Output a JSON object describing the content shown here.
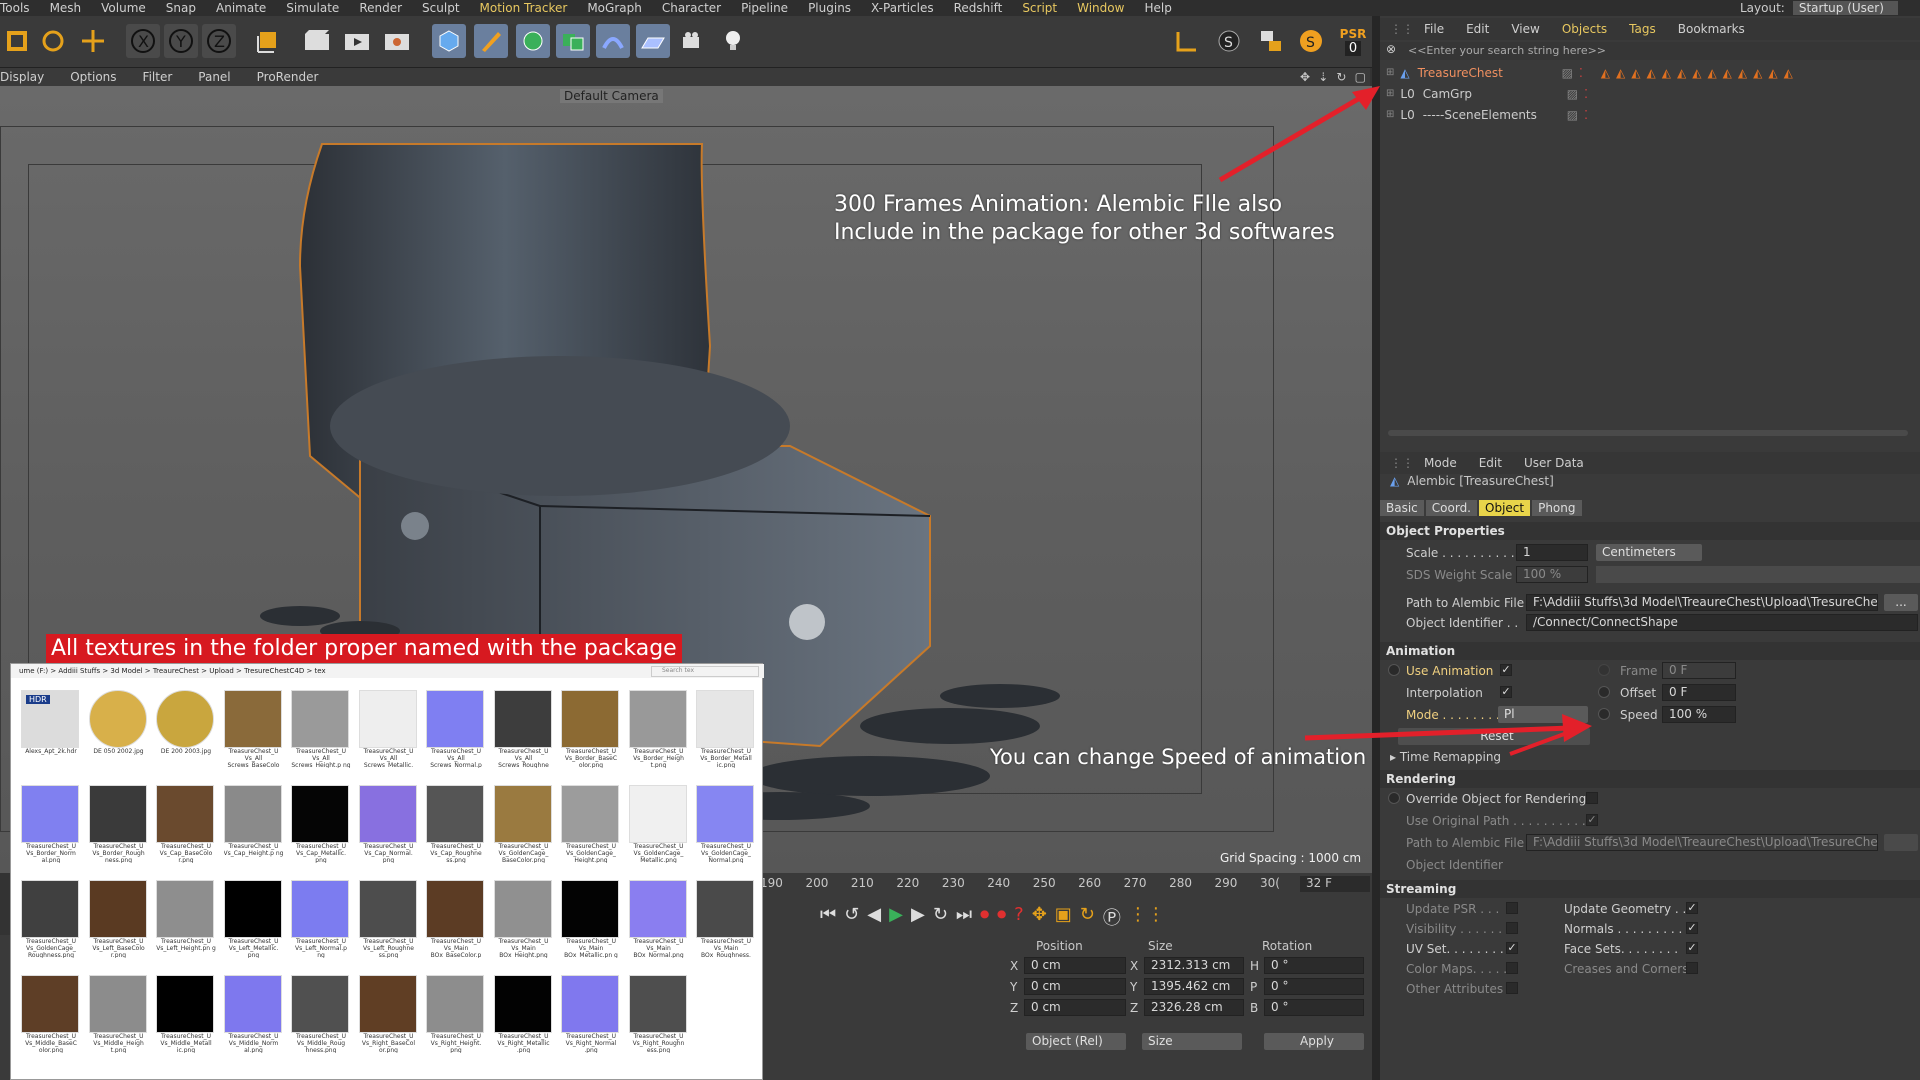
{
  "menubar": [
    "Tools",
    "Mesh",
    "Volume",
    "Snap",
    "Animate",
    "Simulate",
    "Render",
    "Sculpt",
    "Motion Tracker",
    "MoGraph",
    "Character",
    "Pipeline",
    "Plugins",
    "X-Particles",
    "Redshift",
    "Script",
    "Window",
    "Help"
  ],
  "layout": {
    "label": "Layout:",
    "value": "Startup (User)"
  },
  "toolbar": {
    "psr_label": "PSR",
    "psr_value": "0"
  },
  "viewport_menu": [
    "Display",
    "Options",
    "Filter",
    "Panel",
    "ProRender"
  ],
  "viewport": {
    "camera": "Default Camera",
    "grid_spacing": "Grid Spacing : 1000 cm",
    "annotation_top_line1": "300 Frames Animation: Alembic FIle also",
    "annotation_top_line2": "Include in the package for other 3d softwares",
    "annotation_speed": "You can change Speed of animation",
    "annotation_textures": "All textures in the folder proper named with the package"
  },
  "object_manager": {
    "menu": [
      "File",
      "Edit",
      "View",
      "Objects",
      "Tags",
      "Bookmarks"
    ],
    "search_placeholder": "<<Enter your search string here>>",
    "objects": [
      {
        "name": "TreasureChest",
        "selected": true
      },
      {
        "name": "CamGrp"
      },
      {
        "name": "-----SceneElements"
      }
    ]
  },
  "attributes": {
    "menu": [
      "Mode",
      "Edit",
      "User Data"
    ],
    "title": "Alembic [TreasureChest]",
    "tabs": [
      "Basic",
      "Coord.",
      "Object",
      "Phong"
    ],
    "active_tab": "Object",
    "object_properties": "Object Properties",
    "scale_label": "Scale . . . . . . . . . .",
    "scale_value": "1",
    "scale_unit": "Centimeters",
    "sds_label": "SDS Weight Scale",
    "sds_value": "100 %",
    "path_label": "Path to Alembic File",
    "path_value": "F:\\Addiii Stuffs\\3d Model\\TreaureChest\\Upload\\TresureChe",
    "browse": "...",
    "obj_id_label": "Object Identifier . .",
    "obj_id_value": "/Connect/ConnectShape",
    "animation_header": "Animation",
    "use_animation": "Use Animation",
    "frame_label": "Frame",
    "frame_value": "0 F",
    "interpolation": "Interpolation",
    "offset_label": "Offset",
    "offset_value": "0 F",
    "mode_label": "Mode . . . . . . . . .",
    "mode_value": "Pl",
    "speed_label": "Speed",
    "speed_value": "100 %",
    "reset": "Reset",
    "time_remapping": "Time Remapping",
    "rendering_header": "Rendering",
    "override": "Override Object for Rendering",
    "use_original": "Use Original Path . . . . . . . . . .",
    "path2_label": "Path to Alembic File",
    "path2_value": "F:\\Addiii Stuffs\\3d Model\\TreaureChest\\Upload\\TresureChe",
    "obj_id2_label": "Object Identifier",
    "streaming_header": "Streaming",
    "update_psr": "Update PSR . . .",
    "update_geometry": "Update Geometry . .",
    "visibility": "Visibility . . . . . .",
    "normals": "Normals . . . . . . . . . .",
    "uv_set": "UV Set. . . . . . . .",
    "face_sets": "Face Sets. . . . . . . .",
    "color_maps": "Color Maps. . . . .",
    "creases": "Creases and Corners",
    "other_attrs": "Other Attributes"
  },
  "timeline": {
    "ticks": [
      "190",
      "200",
      "210",
      "220",
      "230",
      "240",
      "250",
      "260",
      "270",
      "280",
      "290",
      "30("
    ],
    "current": "32 F"
  },
  "coords": {
    "headers": [
      "Position",
      "Size",
      "Rotation"
    ],
    "rows": [
      {
        "axis": "X",
        "pos": "0 cm",
        "saxis": "X",
        "size": "2312.313 cm",
        "raxis": "H",
        "rot": "0 °"
      },
      {
        "axis": "Y",
        "pos": "0 cm",
        "saxis": "Y",
        "size": "1395.462 cm",
        "raxis": "P",
        "rot": "0 °"
      },
      {
        "axis": "Z",
        "pos": "0 cm",
        "saxis": "Z",
        "size": "2326.28 cm",
        "raxis": "B",
        "rot": "0 °"
      }
    ],
    "mode": "Object (Rel)",
    "size_mode": "Size",
    "apply": "Apply"
  },
  "explorer": {
    "breadcrumb": "ume (F:) > Addiii Stuffs > 3d Model > TreaureChest > Upload > TresureChestC4D > tex",
    "search_placeholder": "Search tex",
    "files": [
      {
        "name": "Alexs_Apt_2k.hdr",
        "color": "#dcdcdc"
      },
      {
        "name": "DE 050 2002.jpg",
        "color": "#d8b04a"
      },
      {
        "name": "DE 200 2003.jpg",
        "color": "#c9a63e"
      },
      {
        "name": "TreasureChest_U Vs_All Screws_BaseColo r.png",
        "color": "#8a6a3a"
      },
      {
        "name": "TreasureChest_U Vs_All Screws_Height.p ng",
        "color": "#9a9a9a"
      },
      {
        "name": "TreasureChest_U Vs_All Screws_Metallic. png",
        "color": "#eeeeee"
      },
      {
        "name": "TreasureChest_U Vs_All Screws_Normal.p ng",
        "color": "#7f7ff2"
      },
      {
        "name": "TreasureChest_U Vs_All Screws_Roughne ss.png",
        "color": "#3d3d3d"
      },
      {
        "name": "TreasureChest_U Vs_Border_BaseC olor.png",
        "color": "#8c6a33"
      },
      {
        "name": "TreasureChest_U Vs_Border_Heigh t.png",
        "color": "#999999"
      },
      {
        "name": "TreasureChest_U Vs_Border_Metall ic.png",
        "color": "#e6e6e6"
      },
      {
        "name": "TreasureChest_U Vs_Border_Norm al.png",
        "color": "#8080f0"
      },
      {
        "name": "TreasureChest_U Vs_Border_Rough ness.png",
        "color": "#3a3a3a"
      },
      {
        "name": "TreasureChest_U Vs_Cap_BaseColo r.png",
        "color": "#6a4a2e"
      },
      {
        "name": "TreasureChest_U Vs_Cap_Height.p ng",
        "color": "#8a8a8a"
      },
      {
        "name": "TreasureChest_U Vs_Cap_Metallic. png",
        "color": "#050505"
      },
      {
        "name": "TreasureChest_U Vs_Cap_Normal. png",
        "color": "#8870e0"
      },
      {
        "name": "TreasureChest_U Vs_Cap_Roughne ss.png",
        "color": "#555555"
      },
      {
        "name": "TreasureChest_U Vs_GoldenCage_ BaseColor.png",
        "color": "#9a7a40"
      },
      {
        "name": "TreasureChest_U Vs_GoldenCage_ Height.png",
        "color": "#9c9c9c"
      },
      {
        "name": "TreasureChest_U Vs_GoldenCage_ Metallic.png",
        "color": "#f0f0f0"
      },
      {
        "name": "TreasureChest_U Vs_GoldenCage_ Normal.png",
        "color": "#8686f2"
      },
      {
        "name": "TreasureChest_U Vs_GoldenCage_ Roughness.png",
        "color": "#404040"
      },
      {
        "name": "TreasureChest_U Vs_Left_BaseColo r.png",
        "color": "#5a3a22"
      },
      {
        "name": "TreasureChest_U Vs_Left_Height.pn g",
        "color": "#8e8e8e"
      },
      {
        "name": "TreasureChest_U Vs_Left_Metallic. png",
        "color": "#000000"
      },
      {
        "name": "TreasureChest_U Vs_Left_Normal.p ng",
        "color": "#7c7cf0"
      },
      {
        "name": "TreasureChest_U Vs_Left_Roughne ss.png",
        "color": "#4d4d4d"
      },
      {
        "name": "TreasureChest_U Vs_Main BOx_BaseColor.p ng",
        "color": "#5c3c24"
      },
      {
        "name": "TreasureChest_U Vs_Main BOx_Height.png",
        "color": "#909090"
      },
      {
        "name": "TreasureChest_U Vs_Main BOx_Metallic.pn g",
        "color": "#030303"
      },
      {
        "name": "TreasureChest_U Vs_Main BOx_Normal.png",
        "color": "#8a7ef0"
      },
      {
        "name": "TreasureChest_U Vs_Main BOx_Roughness. png",
        "color": "#4a4a4a"
      },
      {
        "name": "TreasureChest_U Vs_Middle_BaseC olor.png",
        "color": "#5e3e26"
      },
      {
        "name": "TreasureChest_U Vs_Middle_Heigh t.png",
        "color": "#8c8c8c"
      },
      {
        "name": "TreasureChest_U Vs_Middle_Metall ic.png",
        "color": "#000000"
      },
      {
        "name": "TreasureChest_U Vs_Middle_Norm al.png",
        "color": "#7e78ee"
      },
      {
        "name": "TreasureChest_U Vs_Middle_Roug hness.png",
        "color": "#505050"
      },
      {
        "name": "TreasureChest_U Vs_Right_BaseCol or.png",
        "color": "#603e24"
      },
      {
        "name": "TreasureChest_U Vs_Right_Height. png",
        "color": "#8d8d8d"
      },
      {
        "name": "TreasureChest_U Vs_Right_Metallic .png",
        "color": "#020202"
      },
      {
        "name": "TreasureChest_U Vs_Right_Normal .png",
        "color": "#8078ee"
      },
      {
        "name": "TreasureChest_U Vs_Right_Roughn ess.png",
        "color": "#4e4e4e"
      }
    ]
  }
}
